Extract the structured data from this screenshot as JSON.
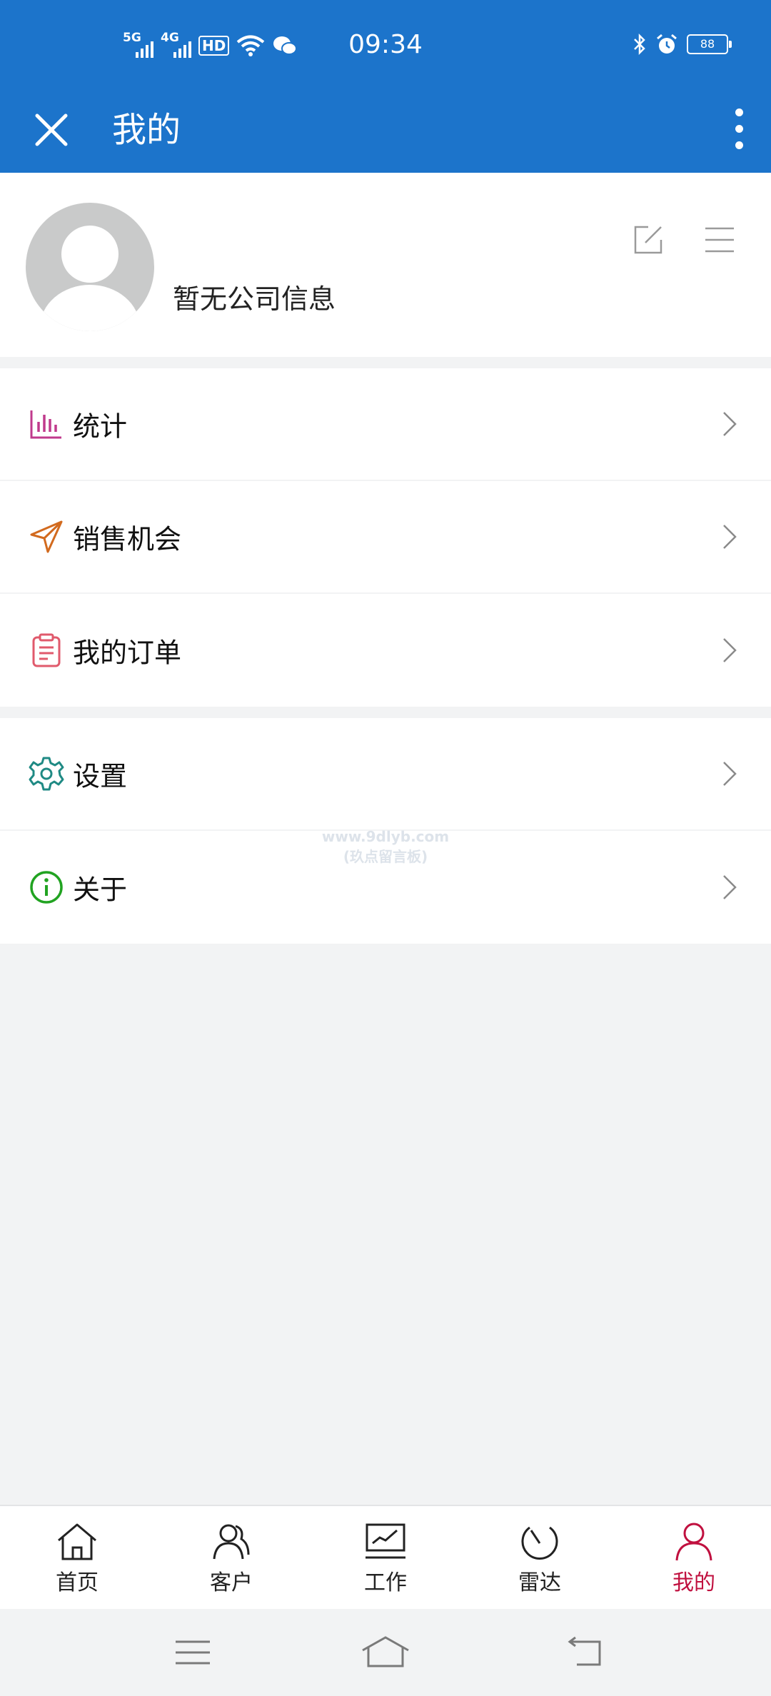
{
  "status_bar": {
    "signal1_label": "5G",
    "signal2_label": "4G",
    "hd_label": "HD",
    "time": "09:34",
    "battery": "88"
  },
  "app_bar": {
    "title": "我的"
  },
  "profile": {
    "company": "暂无公司信息"
  },
  "menu_group1": [
    {
      "label": "统计",
      "icon": "bar-chart-icon",
      "color": "#c03a8c"
    },
    {
      "label": "销售机会",
      "icon": "send-arrow-icon",
      "color": "#d26a1e"
    },
    {
      "label": "我的订单",
      "icon": "clipboard-icon",
      "color": "#e05a6c"
    }
  ],
  "menu_group2": [
    {
      "label": "设置",
      "icon": "gear-icon",
      "color": "#1f8a84"
    },
    {
      "label": "关于",
      "icon": "info-icon",
      "color": "#21a321"
    }
  ],
  "watermark": {
    "line1": "www.9dlyb.com",
    "line2": "(玖点留言板)"
  },
  "bottom_nav": [
    {
      "label": "首页",
      "icon": "home-icon"
    },
    {
      "label": "客户",
      "icon": "customers-icon"
    },
    {
      "label": "工作",
      "icon": "work-icon"
    },
    {
      "label": "雷达",
      "icon": "radar-icon"
    },
    {
      "label": "我的",
      "icon": "user-icon",
      "active": true
    }
  ],
  "colors": {
    "primary": "#1c74cb",
    "active": "#c0103f",
    "background": "#f2f3f4"
  }
}
